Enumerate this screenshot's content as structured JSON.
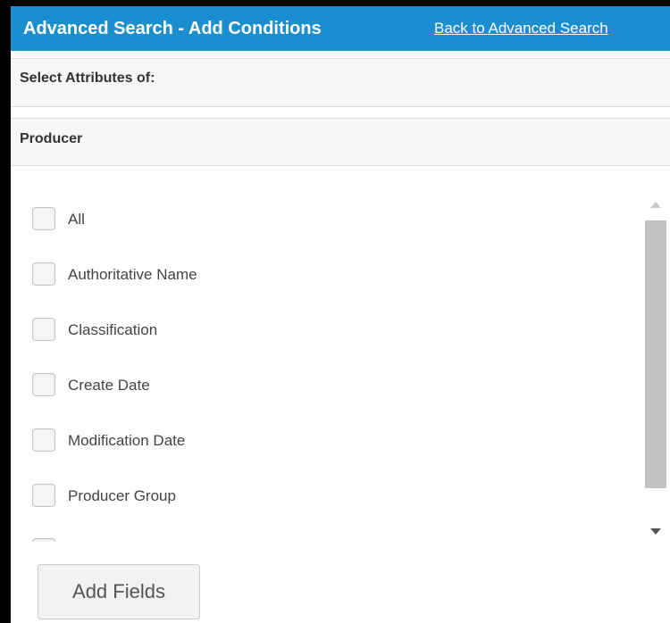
{
  "header": {
    "title": "Advanced Search - Add Conditions",
    "back_link": "Back to Advanced Search",
    "background_color": "#1a8fd0"
  },
  "attributes_section": {
    "label": "Select Attributes of:"
  },
  "entity_section": {
    "label": "Producer"
  },
  "fields": [
    {
      "label": "All",
      "checked": false
    },
    {
      "label": "Authoritative Name",
      "checked": false
    },
    {
      "label": "Classification",
      "checked": false
    },
    {
      "label": "Create Date",
      "checked": false
    },
    {
      "label": "Modification Date",
      "checked": false
    },
    {
      "label": "Producer Group",
      "checked": false
    },
    {
      "label": "",
      "checked": false
    }
  ],
  "actions": {
    "add_fields_label": "Add Fields"
  },
  "scrollbar_icons": {
    "up": "scroll-up-arrow-icon",
    "down": "scroll-down-arrow-icon"
  }
}
